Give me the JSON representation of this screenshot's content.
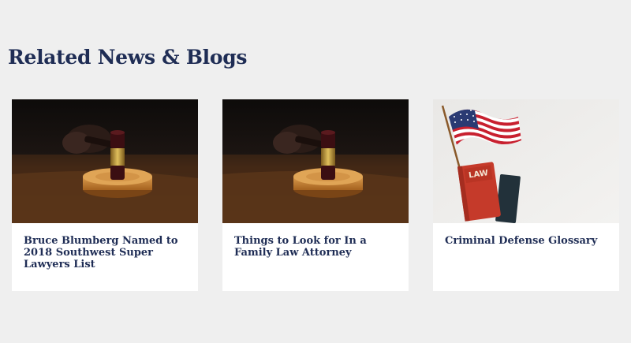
{
  "section": {
    "title": "Related News & Blogs"
  },
  "cards": [
    {
      "title": "Bruce Blumberg Named to 2018 Southwest Super Lawyers List",
      "image": "gavel-photo-icon"
    },
    {
      "title": "Things to Look for In a Family Law Attorney",
      "image": "gavel-photo-icon"
    },
    {
      "title": "Criminal Defense Glossary",
      "image": "flag-law-book-photo-icon",
      "book_label": "LAW"
    }
  ],
  "colors": {
    "background": "#efefef",
    "heading": "#1f2d55",
    "card": "#ffffff"
  }
}
